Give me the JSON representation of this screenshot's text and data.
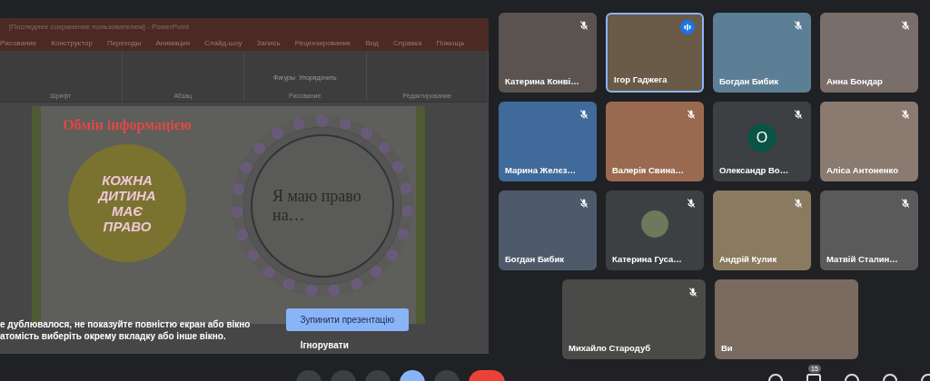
{
  "presentation": {
    "window_title": "[Последнее сохранение пользователем] - PowerPoint",
    "ribbon_tabs": [
      "Рисование",
      "Конструктор",
      "Переходы",
      "Анимация",
      "Слайд-шоу",
      "Запись",
      "Рецензирование",
      "Вид",
      "Справка",
      "Помощь"
    ],
    "ribbon_groups": [
      {
        "label": "Шрифт"
      },
      {
        "label": "Абзац"
      },
      {
        "label": "Рисование",
        "buttons": [
          "Фигуры",
          "Упорядочить"
        ]
      },
      {
        "label": "Редактирование"
      }
    ],
    "slide": {
      "heading": "Обмін інформацією",
      "badge": "КОЖНА ДИТИНА МАЄ ПРАВО",
      "circle_text": "Я маю право на…"
    }
  },
  "share_warning": {
    "lines": [
      "е дублювалося, не показуйте повністю екран або вікно",
      "атомість виберіть окрему вкладку або інше вікно."
    ],
    "primary_button": "Зупинити презентацію",
    "secondary_button": "Ігнорувати"
  },
  "participants": [
    {
      "name": "Катерина Конві…",
      "kind": "video",
      "muted": true,
      "speaking": false
    },
    {
      "name": "Ігор Гаджега",
      "kind": "video",
      "muted": false,
      "speaking": true
    },
    {
      "name": "Богдан Бибик",
      "kind": "video",
      "muted": true,
      "speaking": false
    },
    {
      "name": "Анна Бондар",
      "kind": "video",
      "muted": true,
      "speaking": false
    },
    {
      "name": "Марина Желєз…",
      "kind": "video",
      "muted": true,
      "speaking": false
    },
    {
      "name": "Валерія Свина…",
      "kind": "video",
      "muted": true,
      "speaking": false
    },
    {
      "name": "Олександр Во…",
      "kind": "letter",
      "initial": "О",
      "muted": true,
      "speaking": false
    },
    {
      "name": "Аліса Антоненко",
      "kind": "video",
      "muted": true,
      "speaking": false
    },
    {
      "name": "Богдан Бибик",
      "kind": "video",
      "muted": true,
      "speaking": false
    },
    {
      "name": "Катерина Гуса…",
      "kind": "photo_avatar",
      "muted": true,
      "speaking": false
    },
    {
      "name": "Андрій Кулик",
      "kind": "video",
      "muted": true,
      "speaking": false
    },
    {
      "name": "Матвій Сталин…",
      "kind": "video",
      "muted": true,
      "speaking": false
    },
    {
      "name": "Михайло Стародуб",
      "kind": "video",
      "muted": true,
      "speaking": false
    },
    {
      "name": "Ви",
      "kind": "video",
      "muted": false,
      "speaking": false
    }
  ],
  "participant_count": "15"
}
